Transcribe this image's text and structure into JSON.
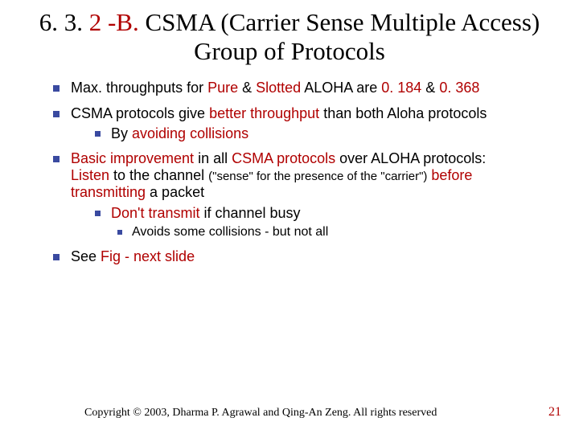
{
  "title": {
    "sectnum": "6. 3.",
    "letter": "2 -B.",
    "rest": " CSMA (Carrier Sense Multiple Access) Group of Protocols"
  },
  "bullets": {
    "b1": {
      "p1": "Max. throughputs for ",
      "pure": "Pure",
      "p2": " & ",
      "slotted": "Slotted",
      "p3": " ALOHA are ",
      "v1": "0. 184",
      "p4": " & ",
      "v2": "0. 368"
    },
    "b2": {
      "p1": "CSMA protocols give ",
      "bt": "better throughput",
      "p2": " than both Aloha protocols",
      "sub_by": "By ",
      "sub_av": "avoiding collisions"
    },
    "b3": {
      "basic": "Basic improvement",
      "p1": " in all ",
      "csma": "CSMA protocols",
      "p2": " over ALOHA protocols:",
      "listen": "Listen",
      "p3": " to the channel ",
      "sense": "(\"sense\" for the presence of the \"carrier\")",
      "before": " before transmitting",
      "p4": " a packet",
      "sub1a": "Don't transmit",
      "sub1b": " if channel busy",
      "sub2": "Avoids some collisions - but not all"
    },
    "b4": {
      "p1": "See ",
      "fig": "Fig -  next slide"
    }
  },
  "footer": {
    "copyright": "Copyright © 2003, Dharma P. Agrawal and Qing-An Zeng. All rights reserved",
    "pagenum": "21"
  }
}
